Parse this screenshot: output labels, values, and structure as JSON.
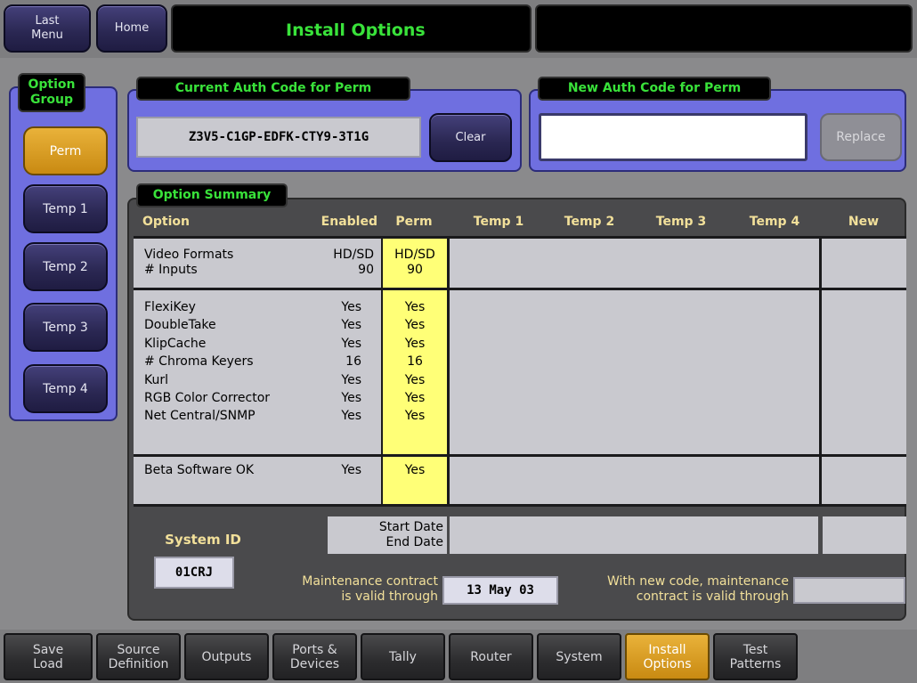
{
  "header": {
    "last_menu": [
      "Last",
      "Menu"
    ],
    "home": "Home",
    "title": "Install Options",
    "status": ""
  },
  "option_group": {
    "label": [
      "Option",
      "Group"
    ],
    "items": [
      {
        "label": "Perm",
        "active": true
      },
      {
        "label": "Temp 1",
        "active": false
      },
      {
        "label": "Temp 2",
        "active": false
      },
      {
        "label": "Temp 3",
        "active": false
      },
      {
        "label": "Temp 4",
        "active": false
      }
    ]
  },
  "current_auth": {
    "label": "Current Auth Code for Perm",
    "code": "Z3V5-C1GP-EDFK-CTY9-3T1G",
    "clear_label": "Clear"
  },
  "new_auth": {
    "label": "New Auth Code for Perm",
    "value": "",
    "replace_label": "Replace"
  },
  "summary": {
    "label": "Option Summary",
    "headers": [
      "Option",
      "Enabled",
      "Perm",
      "Temp 1",
      "Temp 2",
      "Temp 3",
      "Temp 4",
      "New"
    ],
    "group1": {
      "options": "Video Formats\n# Inputs",
      "enabled": "HD/SD\n90",
      "perm": "HD/SD\n90"
    },
    "group2": {
      "options": "FlexiKey\nDoubleTake\nKlipCache\n# Chroma Keyers\nKurl\nRGB Color Corrector\nNet Central/SNMP",
      "enabled": "Yes\nYes\nYes\n16\nYes\nYes\nYes",
      "perm": "Yes\nYes\nYes\n16\nYes\nYes\nYes"
    },
    "group3": {
      "options": "Beta Software OK",
      "enabled": "Yes",
      "perm": "Yes"
    },
    "dates_label": "Start Date\nEnd Date",
    "system_id_label": "System ID",
    "system_id": "01CRJ",
    "maintenance_label": "Maintenance contract\nis valid through",
    "maintenance_date": "13 May 03",
    "new_maintenance_label": "With new code, maintenance\ncontract is valid through",
    "new_maintenance_date": ""
  },
  "tabs": [
    {
      "label": [
        "Save",
        "Load"
      ],
      "active": false
    },
    {
      "label": [
        "Source",
        "Definition"
      ],
      "active": false
    },
    {
      "label": [
        "Outputs"
      ],
      "active": false
    },
    {
      "label": [
        "Ports &",
        "Devices"
      ],
      "active": false
    },
    {
      "label": [
        "Tally"
      ],
      "active": false
    },
    {
      "label": [
        "Router"
      ],
      "active": false
    },
    {
      "label": [
        "System"
      ],
      "active": false
    },
    {
      "label": [
        "Install",
        "Options"
      ],
      "active": true
    },
    {
      "label": [
        "Test",
        "Patterns"
      ],
      "active": false
    }
  ]
}
